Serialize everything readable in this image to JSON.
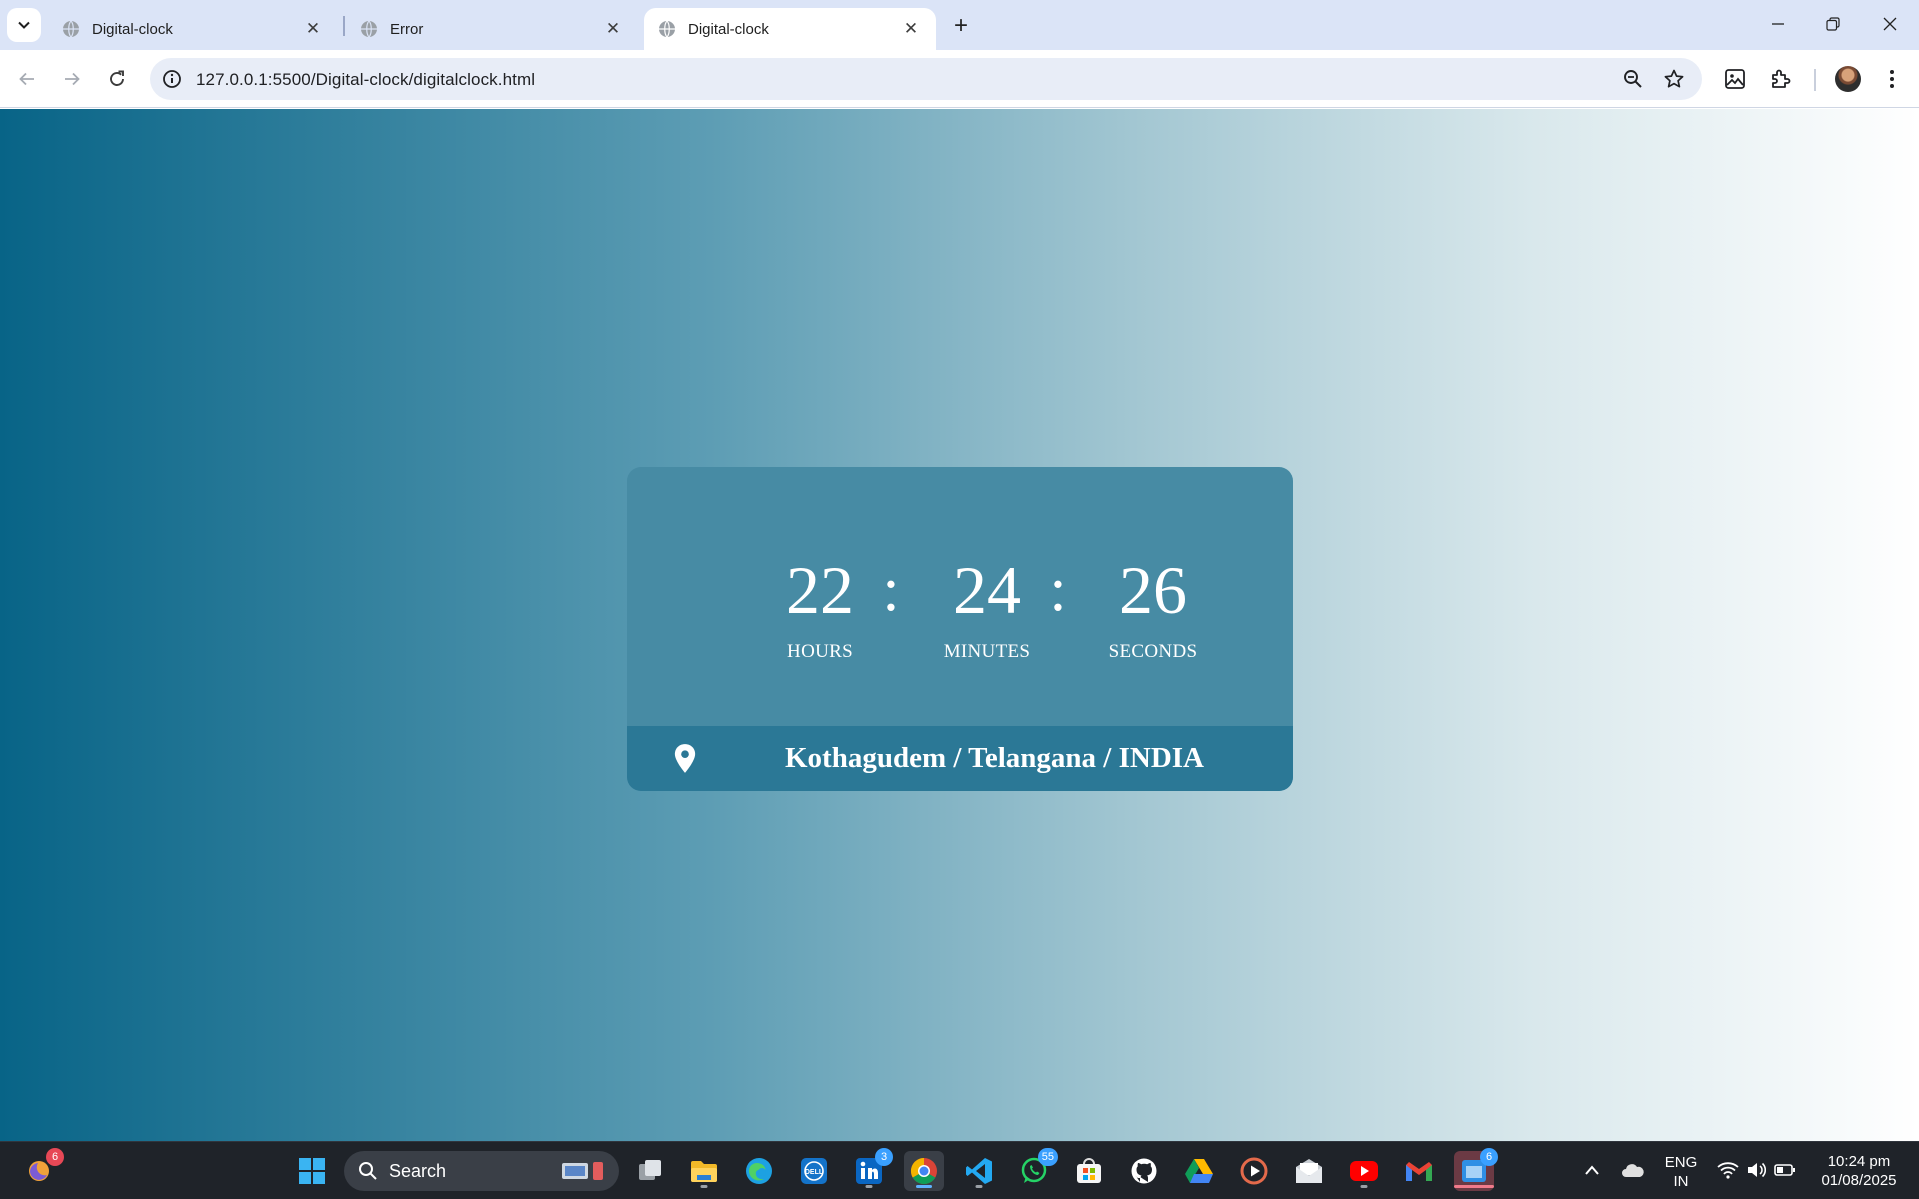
{
  "browser": {
    "tabs": [
      {
        "title": "Digital-clock",
        "active": false
      },
      {
        "title": "Error",
        "active": false
      },
      {
        "title": "Digital-clock",
        "active": true
      }
    ],
    "url": "127.0.0.1:5500/Digital-clock/digitalclock.html"
  },
  "clock": {
    "hours": "22",
    "minutes": "24",
    "seconds": "26",
    "separator": ":",
    "hours_label": "HOURS",
    "minutes_label": "MINUTES",
    "seconds_label": "SECONDS",
    "location": "Kothagudem / Telangana / INDIA"
  },
  "taskbar": {
    "search_placeholder": "Search",
    "badges": {
      "widgets": "6",
      "linkedin": "3",
      "whatsapp": "55",
      "app_active": "6"
    },
    "language_line1": "ENG",
    "language_line2": "IN",
    "time": "10:24 pm",
    "date": "01/08/2025"
  },
  "colors": {
    "gradient_left": "#086487",
    "gradient_right": "#ffffff",
    "card": "#478ba4",
    "location_bar": "#2b7896",
    "tabstrip": "#dbe4f7",
    "taskbar": "#1f2329"
  }
}
